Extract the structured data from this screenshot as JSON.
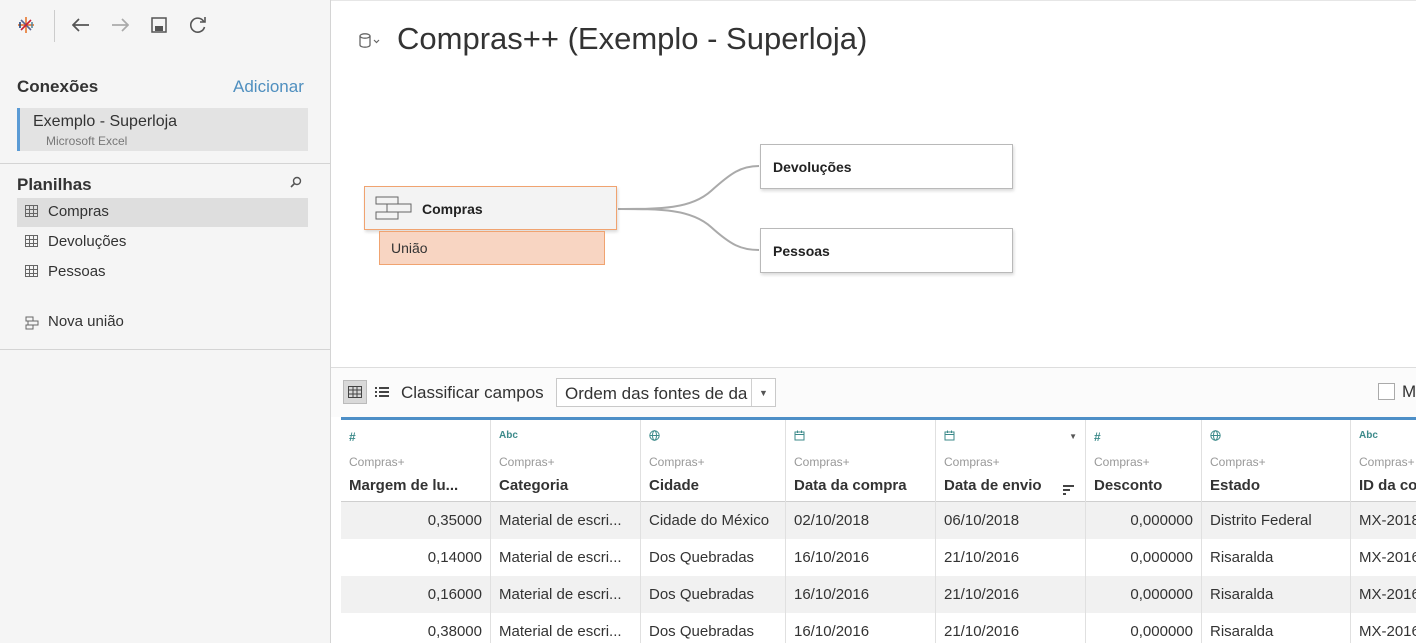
{
  "toolbar": {
    "logo_icon": "tableau-logo-icon",
    "back_icon": "back-arrow-icon",
    "forward_icon": "forward-arrow-icon",
    "save_icon": "save-icon",
    "refresh_icon": "refresh-icon"
  },
  "connections": {
    "title": "Conexões",
    "add_label": "Adicionar",
    "items": [
      {
        "name": "Exemplo - Superloja",
        "type": "Microsoft Excel"
      }
    ]
  },
  "sheets": {
    "title": "Planilhas",
    "items": [
      {
        "label": "Compras",
        "selected": true
      },
      {
        "label": "Devoluções",
        "selected": false
      },
      {
        "label": "Pessoas",
        "selected": false
      }
    ],
    "new_union_label": "Nova união"
  },
  "datasource": {
    "title": "Compras++ (Exemplo - Superloja)",
    "tables": {
      "main": "Compras",
      "union_label": "União",
      "joined": [
        "Devoluções",
        "Pessoas"
      ]
    }
  },
  "gridbar": {
    "sort_label": "Classificar campos",
    "sort_value": "Ordem das fontes de dados",
    "checkbox_label": "M"
  },
  "grid": {
    "columns": [
      {
        "type": "#",
        "source": "Compras+",
        "name": "Margem de lu...",
        "numeric": true
      },
      {
        "type": "Abc",
        "source": "Compras+",
        "name": "Categoria",
        "numeric": false
      },
      {
        "type": "globe",
        "source": "Compras+",
        "name": "Cidade",
        "numeric": false
      },
      {
        "type": "date",
        "source": "Compras+",
        "name": "Data da compra",
        "numeric": false
      },
      {
        "type": "date",
        "source": "Compras+",
        "name": "Data de envio",
        "numeric": false
      },
      {
        "type": "#",
        "source": "Compras+",
        "name": "Desconto",
        "numeric": true
      },
      {
        "type": "globe",
        "source": "Compras+",
        "name": "Estado",
        "numeric": false
      },
      {
        "type": "Abc",
        "source": "Compras+",
        "name": "ID da co",
        "numeric": false
      }
    ],
    "rows": [
      [
        "0,35000",
        "Material de escri...",
        "Cidade do México",
        "02/10/2018",
        "06/10/2018",
        "0,000000",
        "Distrito Federal",
        "MX-2018"
      ],
      [
        "0,14000",
        "Material de escri...",
        "Dos Quebradas",
        "16/10/2016",
        "21/10/2016",
        "0,000000",
        "Risaralda",
        "MX-2016"
      ],
      [
        "0,16000",
        "Material de escri...",
        "Dos Quebradas",
        "16/10/2016",
        "21/10/2016",
        "0,000000",
        "Risaralda",
        "MX-2016"
      ],
      [
        "0,38000",
        "Material de escri...",
        "Dos Quebradas",
        "16/10/2016",
        "21/10/2016",
        "0,000000",
        "Risaralda",
        "MX-2016"
      ]
    ]
  },
  "colors": {
    "accent_blue": "#4d8fc7",
    "union_fill": "#f8d5c2",
    "union_border": "#f0a370",
    "link_blue": "#4f8fbf"
  }
}
